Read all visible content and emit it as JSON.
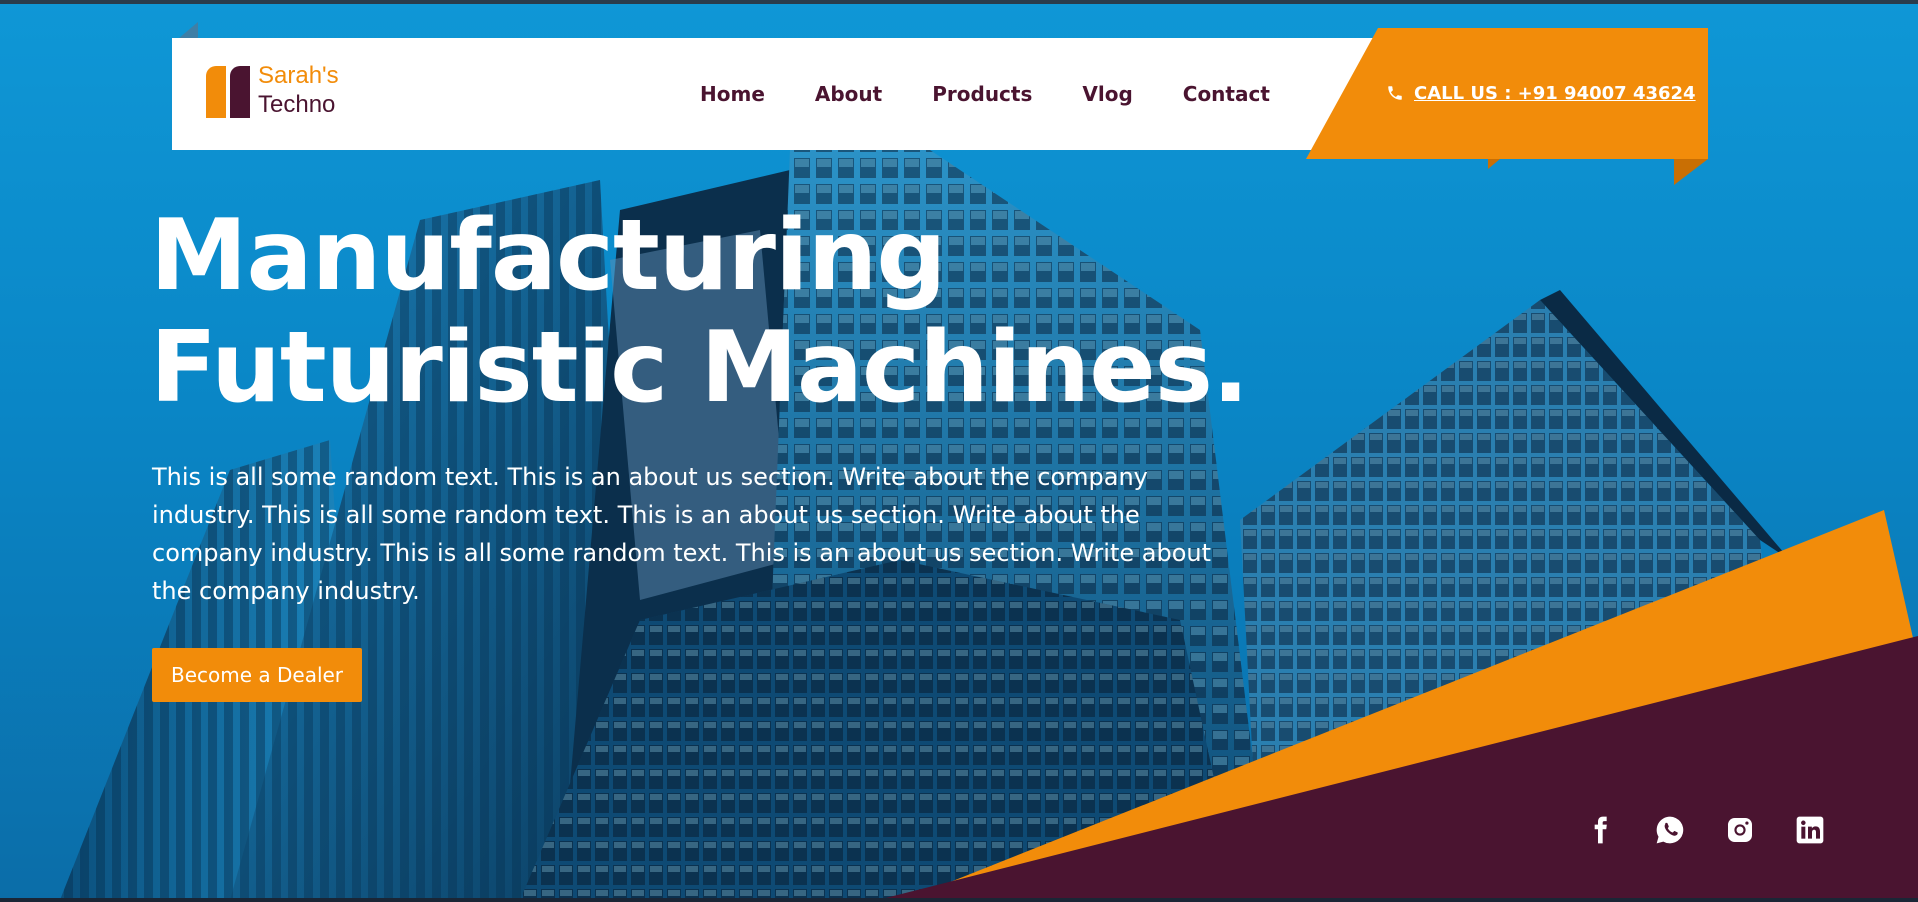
{
  "brand": {
    "line1": "Sarah's",
    "line2": "Techno",
    "primary_color": "#f28c0a",
    "secondary_color": "#4a1430"
  },
  "nav": {
    "items": [
      {
        "label": "Home"
      },
      {
        "label": "About"
      },
      {
        "label": "Products"
      },
      {
        "label": "Vlog"
      },
      {
        "label": "Contact"
      }
    ]
  },
  "call": {
    "label": "CALL US : +91 94007 43624",
    "icon": "phone-icon"
  },
  "hero": {
    "headline_line1": "Manufacturing",
    "headline_line2": "Futuristic Machines.",
    "description_lines": [
      "This is all some random text. This is an about us section. Write about the company",
      "industry. This is all some random text. This is an about us section. Write about the",
      "company industry. This is all some random text. This is an about us section. Write about",
      "the company industry."
    ],
    "cta_label": "Become a Dealer",
    "background_color": "#0f97d6"
  },
  "socials": [
    {
      "icon": "facebook-icon"
    },
    {
      "icon": "whatsapp-icon"
    },
    {
      "icon": "instagram-icon"
    },
    {
      "icon": "linkedin-icon"
    }
  ]
}
